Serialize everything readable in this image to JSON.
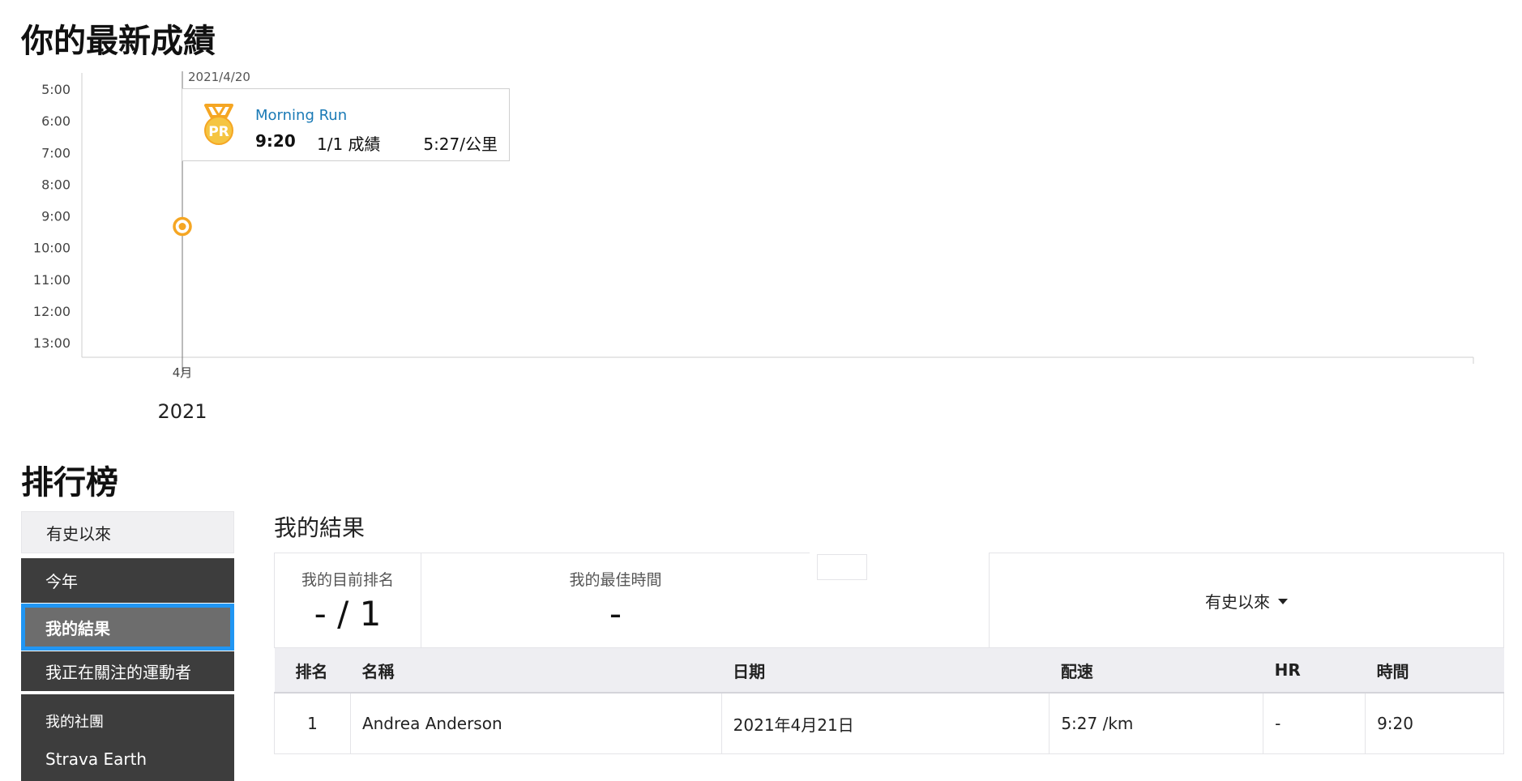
{
  "sections": {
    "latest_title": "你的最新成績",
    "leaderboard_title": "排行榜"
  },
  "chart_data": {
    "type": "scatter",
    "title": "",
    "y_tick_labels": [
      "5:00",
      "6:00",
      "7:00",
      "8:00",
      "9:00",
      "10:00",
      "11:00",
      "12:00",
      "13:00"
    ],
    "y_axis": {
      "ylim": [
        "5:00",
        "13:00"
      ],
      "inverted": true
    },
    "x_tick_labels": [
      "4月"
    ],
    "x_year_label": "2021",
    "points": [
      {
        "date": "2021/4/20",
        "time": "9:20"
      }
    ],
    "grid": false,
    "tooltip": {
      "date": "2021/4/20",
      "activity_name": "Morning Run",
      "time": "9:20",
      "rank": "1/1 成績",
      "pace": "5:27/公里",
      "badge": "PR"
    }
  },
  "colors": {
    "accent": "#1a7ab6",
    "pr_orange": "#f5a623",
    "sidebar_dark": "#3d3d3d",
    "selected_outline": "#2196f3"
  },
  "sidebar": {
    "all_time": "有史以來",
    "this_year": "今年",
    "my_results": "我的結果",
    "following": "我正在關注的運動者",
    "clubs_title": "我的社團",
    "club_earth": "Strava Earth"
  },
  "results": {
    "title": "我的結果",
    "current_rank_label": "我的目前排名",
    "current_rank_value": "- / 1",
    "best_time_label": "我的最佳時間",
    "best_time_value": "-",
    "filter_value": "有史以來",
    "columns": [
      "排名",
      "名稱",
      "日期",
      "配速",
      "HR",
      "時間"
    ],
    "rows": [
      {
        "rank": "1",
        "name": "Andrea Anderson",
        "date": "2021年4月21日",
        "pace": "5:27 /km",
        "hr": "-",
        "time": "9:20"
      }
    ]
  },
  "icons": {
    "pr_medal": "pr-medal-icon",
    "caret": "caret-down-icon"
  }
}
